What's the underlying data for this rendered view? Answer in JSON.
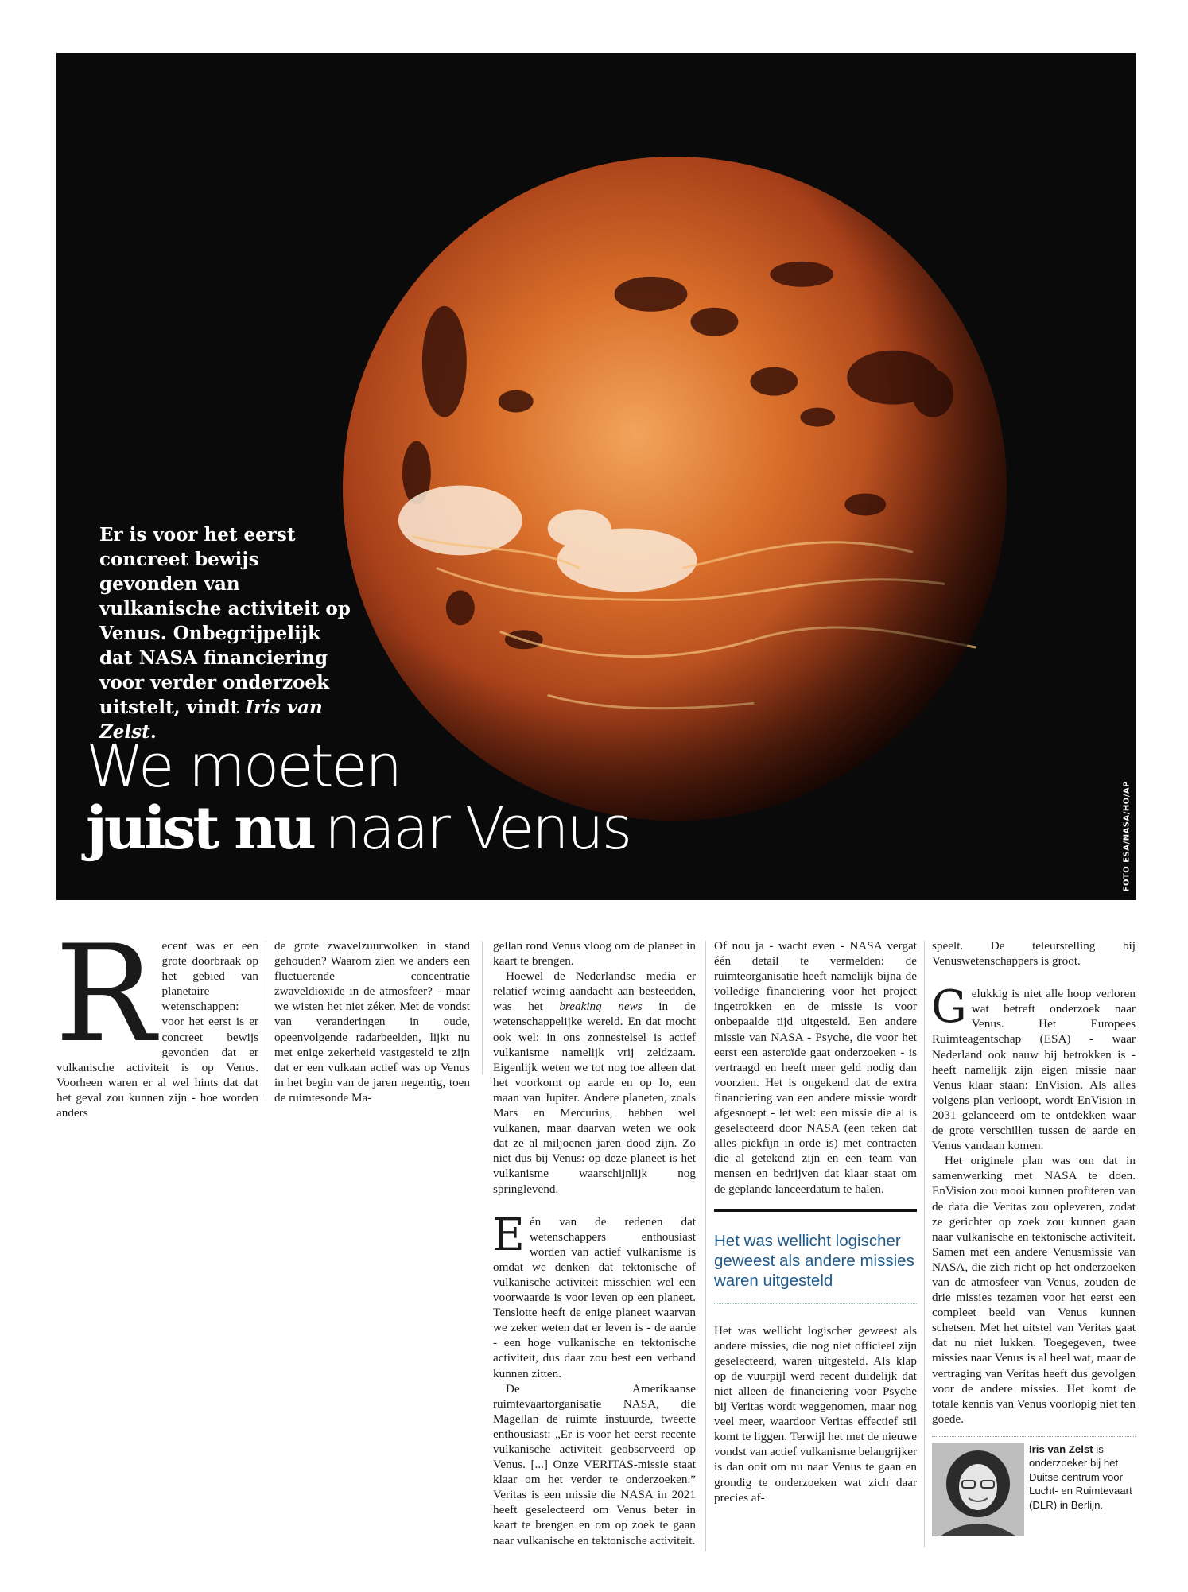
{
  "hero": {
    "intro_part1": "Er is voor het eerst concreet bewijs gevonden van vulkanische activiteit op Venus. Onbegrijpelijk dat NASA financiering voor verder onderzoek uitstelt, vindt ",
    "intro_author": "Iris van Zelst",
    "intro_end": ".",
    "headline_line1": "We moeten",
    "headline_bold": "juist nu",
    "headline_rest": "naar Venus",
    "photo_credit": "FOTO ESA/NASA/HO/AP"
  },
  "article": {
    "col1_dropcap": "R",
    "col1_text": "ecent was er een grote doorbraak op het gebied van planetaire wetenschappen: voor het eerst is er concreet bewijs gevonden dat er vulkanische activiteit is op Venus. Voorheen waren er al wel hints dat dat het geval zou kunnen zijn - hoe worden anders",
    "col2_text": "de grote zwavelzuurwolken in stand gehouden? Waarom zien we anders een fluctuerende concentratie zwaveldioxide in de atmosfeer? - maar we wisten het niet zéker. Met de vondst van veranderingen in oude, opeenvolgende radarbeelden, lijkt nu met enige zekerheid vastgesteld te zijn dat er een vulkaan actief was op Venus in het begin van de jaren negentig, toen de ruimtesonde Ma-",
    "col3_p1": "gellan rond Venus vloog om de planeet in kaart te brengen.",
    "col3_p2_a": "Hoewel de Nederlandse media er relatief weinig aandacht aan besteedden, was het ",
    "col3_p2_em": "breaking news",
    "col3_p2_b": " in de wetenschappelijke wereld. En dat mocht ook wel: in ons zonnestelsel is actief vulkanisme namelijk vrij zeldzaam. Eigenlijk weten we tot nog toe alleen dat het voorkomt op aarde en op Io, een maan van Jupiter. Andere planeten, zoals Mars en Mercurius, hebben wel vulkanen, maar daarvan weten we ook dat ze al miljoenen jaren dood zijn. Zo niet dus bij Venus: op deze planeet is het vulkanisme waarschijnlijk nog springlevend.",
    "col3_dropcap": "E",
    "col3_p3": "én van de redenen dat wetenschappers enthousiast worden van actief vulkanisme is omdat we denken dat tektonische of vulkanische activiteit misschien wel een voorwaarde is voor leven op een planeet. Tenslotte heeft de enige planeet waarvan we zeker weten dat er leven is - de aarde - een hoge vulkanische en tektonische activiteit, dus daar zou best een verband kunnen zitten.",
    "col3_p4": "De Amerikaanse ruimtevaartorganisatie NASA, die Magellan de ruimte instuurde, tweette enthousiast: „Er is voor het eerst recente vulkanische activiteit geobserveerd op Venus. [...] Onze VERITAS-missie staat klaar om het verder te onderzoeken.” Veritas is een missie die NASA in 2021 heeft geselecteerd om Venus beter in kaart te brengen en om op zoek te gaan naar vulkanische en tektonische activiteit.",
    "col4_p1": "Of nou ja - wacht even - NASA vergat één detail te vermelden: de ruimteorganisatie heeft namelijk bijna de volledige financiering voor het project ingetrokken en de missie is voor onbepaalde tijd uitgesteld. Een andere missie van NASA - Psyche, die voor het eerst een asteroïde gaat onderzoeken - is vertraagd en heeft meer geld nodig dan voorzien. Het is ongekend dat de extra financiering van een andere missie wordt afgesnoept - let wel: een missie die al is geselecteerd door NASA (een teken dat alles piekfijn in orde is) met contracten die al getekend zijn en een team van mensen en bedrijven dat klaar staat om de geplande lanceerdatum te halen.",
    "pull_quote": "Het was wellicht logischer geweest als andere missies waren uitgesteld",
    "col4_p2": "Het was wellicht logischer geweest als andere missies, die nog niet officieel zijn geselecteerd, waren uitgesteld. Als klap op de vuurpijl werd recent duidelijk dat niet alleen de financiering voor Psyche bij Veritas wordt weggenomen, maar nog veel meer, waardoor Veritas effectief stil komt te liggen. Terwijl het met de nieuwe vondst van actief vulkanisme belangrijker is dan ooit om nu naar Venus te gaan en grondig te onderzoeken wat zich daar precies af-",
    "col5_p1": "speelt. De teleurstelling bij Venuswetenschappers is groot.",
    "col5_dropcap": "G",
    "col5_p2": "elukkig is niet alle hoop verloren wat betreft onderzoek naar Venus. Het Europees Ruimteagentschap (ESA) - waar Nederland ook nauw bij betrokken is - heeft namelijk zijn eigen missie naar Venus klaar staan: EnVision. Als alles volgens plan verloopt, wordt EnVision in 2031 gelanceerd om te ontdekken waar de grote verschillen tussen de aarde en Venus vandaan komen.",
    "col5_p3": "Het originele plan was om dat in samenwerking met NASA te doen. EnVision zou mooi kunnen profiteren van de data die Veritas zou opleveren, zodat ze gerichter op zoek zou kunnen gaan naar vulkanische en tektonische activiteit. Samen met een andere Venusmissie van NASA, die zich richt op het onderzoeken van de atmosfeer van Venus, zouden de drie missies tezamen voor het eerst een compleet beeld van Venus kunnen schetsen. Met het uitstel van Veritas gaat dat nu niet lukken. Toegegeven, twee missies naar Venus is al heel wat, maar de vertraging van Veritas heeft dus gevolgen voor de andere missies. Het komt de totale kennis van Venus voorlopig niet ten goede."
  },
  "author_box": {
    "name": "Iris van Zelst",
    "bio": " is onderzoeker bij het Duitse centrum voor Lucht- en Ruimtevaart (DLR) in Berlijn."
  }
}
